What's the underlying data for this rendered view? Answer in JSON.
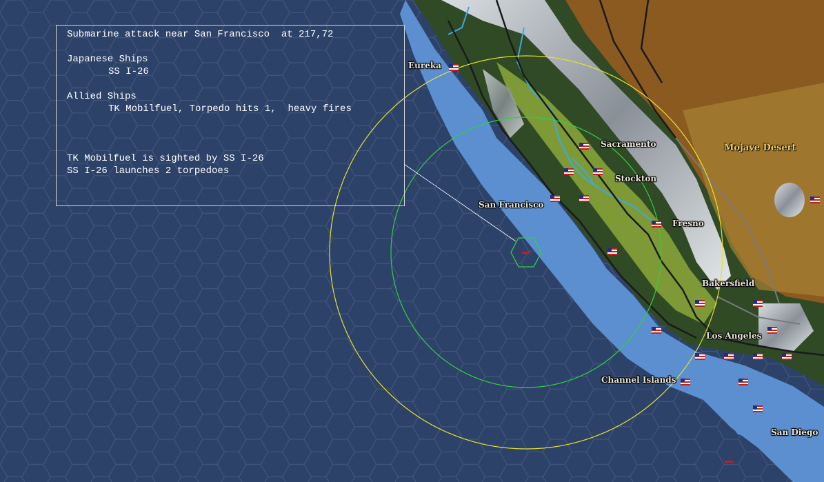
{
  "report": {
    "title": "Submarine attack near San Francisco  at 217,72",
    "japanese_header": "Japanese Ships",
    "japanese_ships": [
      "SS I-26"
    ],
    "allied_header": "Allied Ships",
    "allied_ships": [
      "TK Mobilfuel, Torpedo hits 1,  heavy fires"
    ],
    "events": [
      "TK Mobilfuel is sighted by SS I-26",
      "SS I-26 launches 2 torpedoes"
    ]
  },
  "cities": {
    "eureka": "Eureka",
    "sacramento": "Sacramento",
    "stockton": "Stockton",
    "san_francisco": "San Francisco",
    "fresno": "Fresno",
    "bakersfield": "Bakersfield",
    "los_angeles": "Los Angeles",
    "san_diego": "San Diego"
  },
  "regions": {
    "channel_islands": "Channel Islands",
    "mojave_desert": "Mojave Desert"
  },
  "colors": {
    "ocean": "#2d4268",
    "shallow": "#5b8fcf",
    "land": "#2f4a25",
    "desert": "#8a5a20",
    "yellow_range": "#e8e030",
    "green_range": "#30d040",
    "flag": "us-flag"
  }
}
